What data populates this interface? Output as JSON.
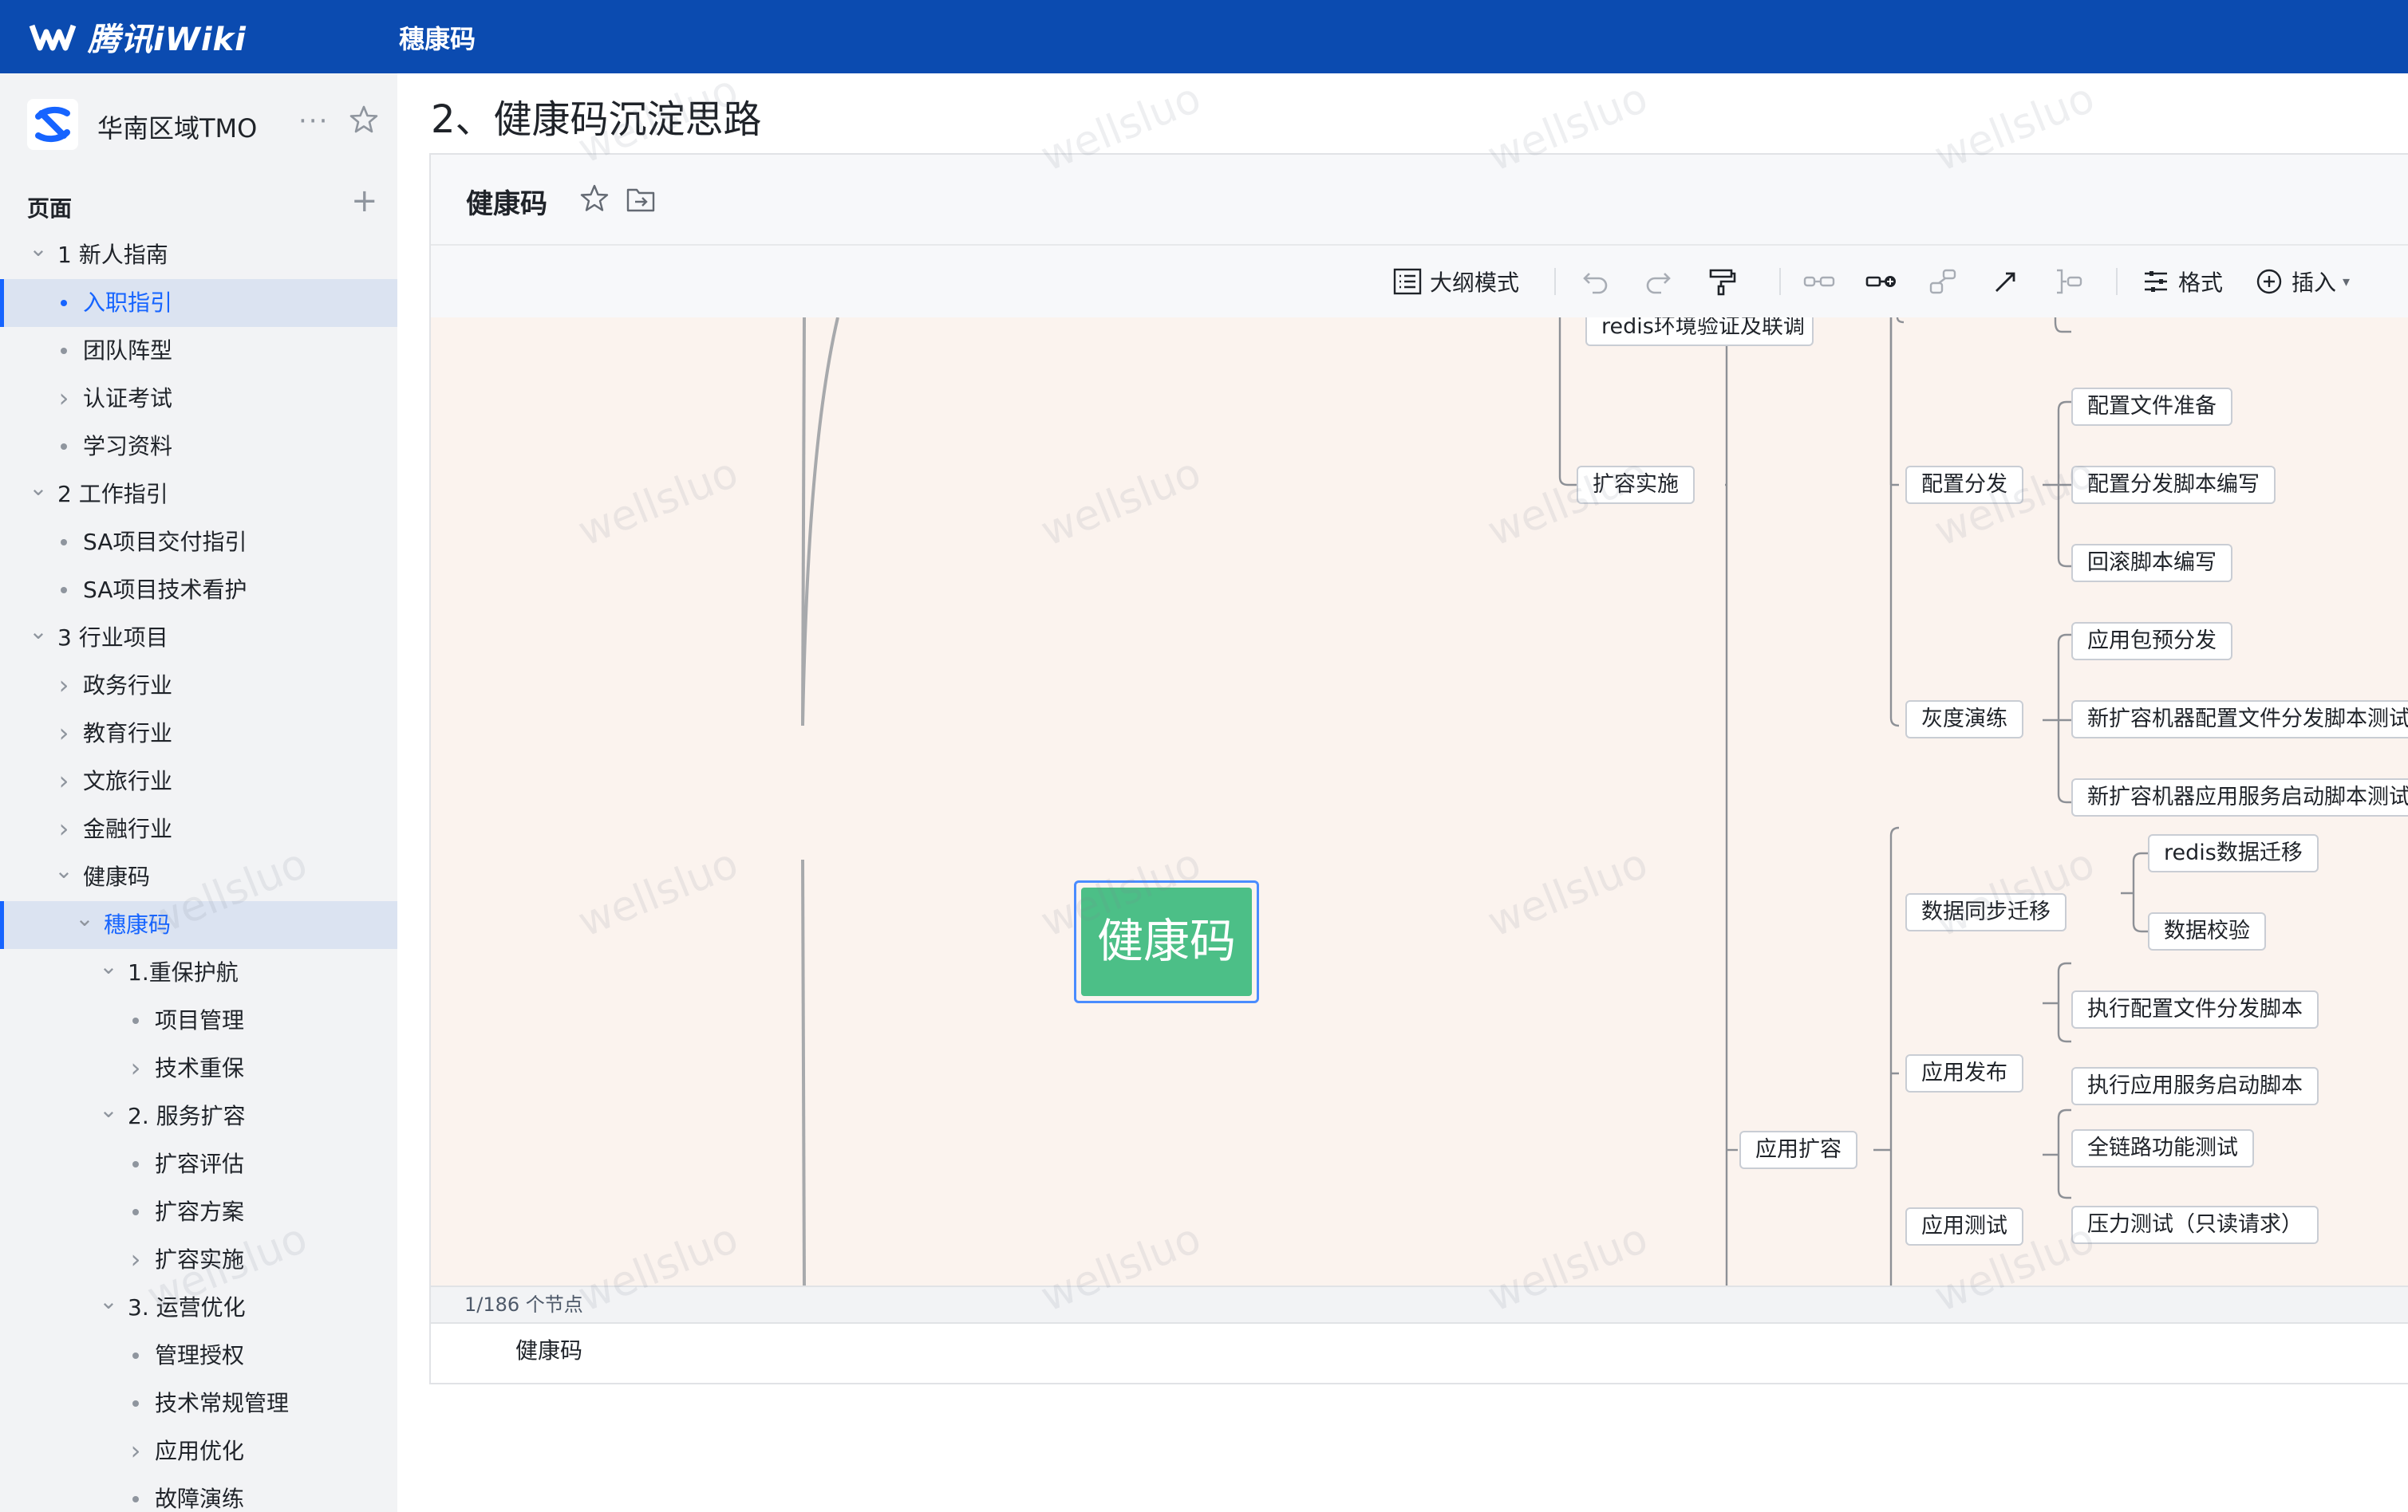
{
  "topbar": {
    "brand": "腾讯iWiki",
    "title": "穗康码"
  },
  "sidebar": {
    "space_name": "华南区域TMO",
    "more": "···",
    "pages_label": "页面",
    "add": "+",
    "tree": [
      {
        "label": "1 新人指南",
        "level": 0,
        "lead": "expanded",
        "active": false
      },
      {
        "label": "入职指引",
        "level": 1,
        "lead": "dot",
        "active": true
      },
      {
        "label": "团队阵型",
        "level": 1,
        "lead": "dot",
        "active": false
      },
      {
        "label": "认证考试",
        "level": 1,
        "lead": "collapsed",
        "active": false
      },
      {
        "label": "学习资料",
        "level": 1,
        "lead": "dot",
        "active": false
      },
      {
        "label": "2 工作指引",
        "level": 0,
        "lead": "expanded",
        "active": false
      },
      {
        "label": "SA项目交付指引",
        "level": 1,
        "lead": "dot",
        "active": false
      },
      {
        "label": "SA项目技术看护",
        "level": 1,
        "lead": "dot",
        "active": false
      },
      {
        "label": "3 行业项目",
        "level": 0,
        "lead": "expanded",
        "active": false
      },
      {
        "label": "政务行业",
        "level": 1,
        "lead": "collapsed",
        "active": false
      },
      {
        "label": "教育行业",
        "level": 1,
        "lead": "collapsed",
        "active": false
      },
      {
        "label": "文旅行业",
        "level": 1,
        "lead": "collapsed",
        "active": false
      },
      {
        "label": "金融行业",
        "level": 1,
        "lead": "collapsed",
        "active": false
      },
      {
        "label": "健康码",
        "level": 1,
        "lead": "expanded",
        "active": false
      },
      {
        "label": "穗康码",
        "level": 2,
        "lead": "expanded",
        "active": true
      },
      {
        "label": "1.重保护航",
        "level": 3,
        "lead": "expanded",
        "active": false
      },
      {
        "label": "项目管理",
        "level": 4,
        "lead": "dot",
        "active": false
      },
      {
        "label": "技术重保",
        "level": 4,
        "lead": "collapsed",
        "active": false
      },
      {
        "label": "2. 服务扩容",
        "level": 3,
        "lead": "expanded",
        "active": false
      },
      {
        "label": "扩容评估",
        "level": 4,
        "lead": "dot",
        "active": false
      },
      {
        "label": "扩容方案",
        "level": 4,
        "lead": "dot",
        "active": false
      },
      {
        "label": "扩容实施",
        "level": 4,
        "lead": "collapsed",
        "active": false
      },
      {
        "label": "3. 运营优化",
        "level": 3,
        "lead": "expanded",
        "active": false
      },
      {
        "label": "管理授权",
        "level": 4,
        "lead": "dot",
        "active": false
      },
      {
        "label": "技术常规管理",
        "level": 4,
        "lead": "dot",
        "active": false
      },
      {
        "label": "应用优化",
        "level": 4,
        "lead": "collapsed",
        "active": false
      },
      {
        "label": "故障演练",
        "level": 4,
        "lead": "dot",
        "active": false
      }
    ]
  },
  "main": {
    "page_title": "2、健康码沉淀思路",
    "doc_name": "健康码",
    "toolbar": {
      "outline": "大纲模式",
      "format": "格式",
      "insert": "插入"
    },
    "status": "1/186 个节点",
    "breadcrumb": "健康码"
  },
  "mindmap": {
    "root": "健康码",
    "nodes": {
      "n_redis_env": "redis环境验证及联调",
      "n_kuorong_shishi": "扩容实施",
      "n_peizhi_fenfa": "配置分发",
      "n_peizhi_zhunbei": "配置文件准备",
      "n_peizhi_jiaoben": "配置分发脚本编写",
      "n_huigun": "回滚脚本编写",
      "n_huidu": "灰度演练",
      "n_yingyongbao": "应用包预分发",
      "n_xin_peizhi": "新扩容机器配置文件分发脚本测试",
      "n_xin_yingyong": "新扩容机器应用服务启动脚本测试",
      "n_shuju_tongbu": "数据同步迁移",
      "n_redis_qianyi": "redis数据迁移",
      "n_shuju_jiaoyan": "数据校验",
      "n_yingyong_kuorong": "应用扩容",
      "n_yingyong_fabu": "应用发布",
      "n_zhixing_peizhi": "执行配置文件分发脚本",
      "n_zhixing_qidong": "执行应用服务启动脚本",
      "n_yingyong_ceshi": "应用测试",
      "n_quanlianlu": "全链路功能测试",
      "n_yali": "压力测试（只读请求）"
    }
  },
  "colors": {
    "topbar": "#0b4bb0",
    "accent": "#1664ff",
    "root_node": "#4cbf87",
    "canvas": "#fbf3ee"
  },
  "icons": [
    "logo-mark-icon",
    "space-logo-icon",
    "more-icon",
    "star-icon",
    "plus-icon",
    "chevron-down-icon",
    "chevron-right-icon",
    "move-icon",
    "outline-icon",
    "undo-icon",
    "redo-icon",
    "format-painter-icon",
    "add-sibling-icon",
    "add-child-icon",
    "add-parent-icon",
    "relation-line-icon",
    "summary-icon",
    "format-icon",
    "insert-plus-icon"
  ]
}
